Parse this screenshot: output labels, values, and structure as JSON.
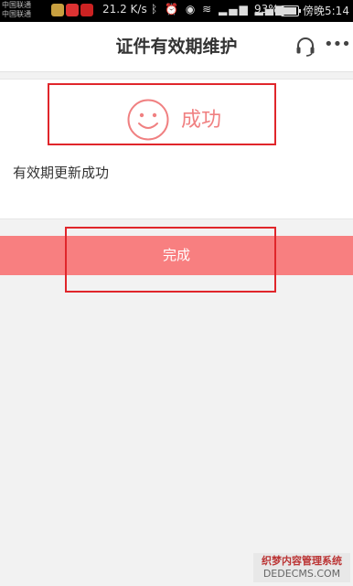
{
  "status_bar": {
    "carrier_1": "中国联通",
    "carrier_2": "中国联通",
    "network_speed": "21.2 K/s",
    "battery_percent": "93%",
    "battery_level": 0.93,
    "time": "傍晚5:14",
    "icons": [
      "bluetooth-icon",
      "alarm-icon",
      "eye-icon",
      "wifi-icon",
      "signal-2g-icon",
      "signal-4g-icon",
      "battery-icon"
    ]
  },
  "header": {
    "title": "证件有效期维护",
    "icons": [
      "headset-icon",
      "more-icon"
    ]
  },
  "result": {
    "status_text": "成功",
    "message": "有效期更新成功",
    "accent_color": "#f08081"
  },
  "actions": {
    "done_label": "完成",
    "done_color": "#f87f80"
  },
  "watermark": {
    "line1": "织梦内容管理系统",
    "line2": "DEDECMS.COM"
  }
}
